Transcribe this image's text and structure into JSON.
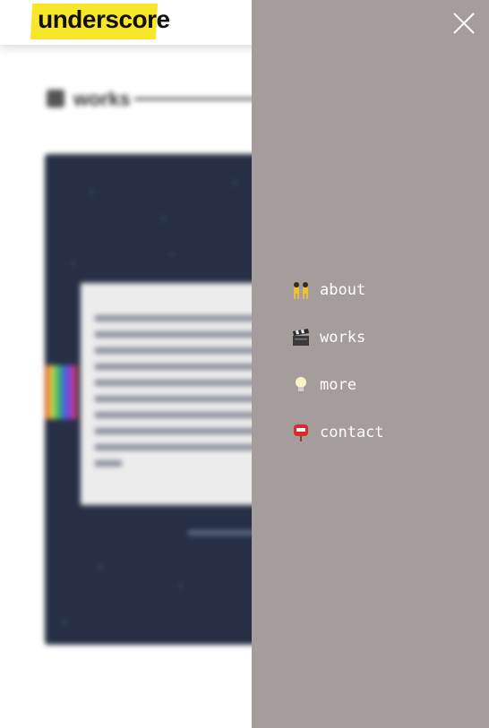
{
  "brand": {
    "logo_text": "underscore",
    "accent": "#f7e62a"
  },
  "section": {
    "label": "works"
  },
  "menu": {
    "background": "#a59c9c",
    "items": [
      {
        "label": "about",
        "icon": "people-icon"
      },
      {
        "label": "works",
        "icon": "clapperboard-icon"
      },
      {
        "label": "more",
        "icon": "lightbulb-icon"
      },
      {
        "label": "contact",
        "icon": "mailbox-icon"
      }
    ]
  }
}
